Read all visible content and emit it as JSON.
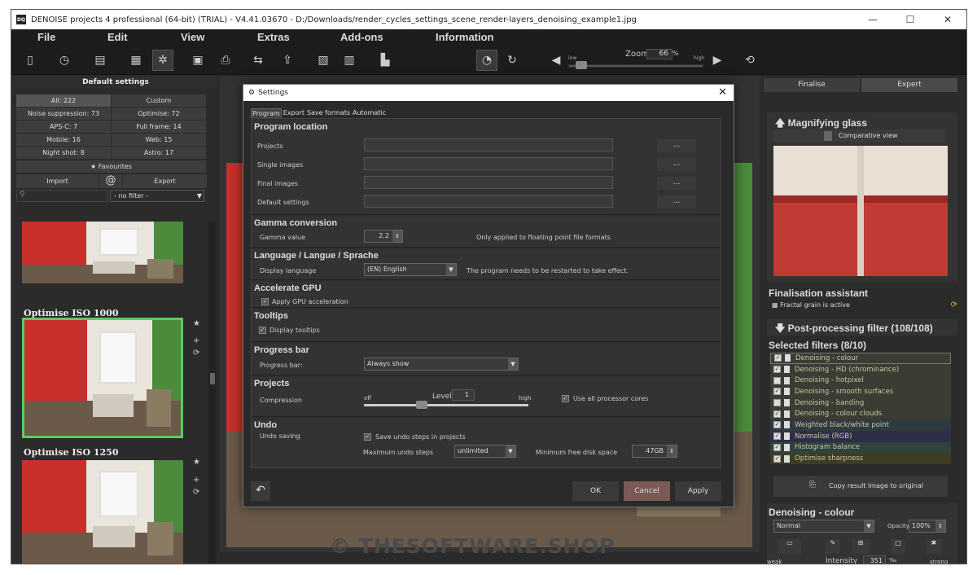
{
  "titlebar": {
    "app_icon": "DQ",
    "title": "DENOISE projects 4 professional (64-bit) (TRIAL) - V4.41.03670 - D:/Downloads/render_cycles_settings_scene_render-layers_denoising_example1.jpg",
    "minimize": "—",
    "maximize": "☐",
    "close": "✕"
  },
  "menu": {
    "file": "File",
    "edit": "Edit",
    "view": "View",
    "extras": "Extras",
    "addons": "Add-ons",
    "information": "Information"
  },
  "zoom": {
    "label": "Zoom",
    "value": "66",
    "unit": "%",
    "low": "low",
    "high": "high"
  },
  "left_panel": {
    "title": "Default settings",
    "presets": [
      {
        "label": "All: 222",
        "active": true
      },
      {
        "label": "Custom"
      },
      {
        "label": "Noise suppression: 73"
      },
      {
        "label": "Optimise: 72"
      },
      {
        "label": "APS-C: 7"
      },
      {
        "label": "Full frame: 14"
      },
      {
        "label": "Mobile: 16"
      },
      {
        "label": "Web: 15"
      },
      {
        "label": "Night shot: 8"
      },
      {
        "label": "Astro: 17"
      }
    ],
    "favourites": "Favourites",
    "import": "Import",
    "at": "@",
    "export": "Export",
    "filter": "- no filter -",
    "thumbs": [
      {
        "label": "Optimise ISO 1000"
      },
      {
        "label": "Optimise ISO 1250"
      }
    ]
  },
  "watermark": "© THESOFTWARE.SHOP",
  "right_panel": {
    "tabs": [
      "Finalise",
      "Expert"
    ],
    "magnifier_title": "Magnifying glass",
    "comparative": "Comparative view",
    "finalisation_title": "Finalisation assistant",
    "fractal": "Fractal grain is active",
    "postfilter_title": "Post-processing filter (108/108)",
    "selected_title": "Selected filters (8/10)",
    "filters": [
      {
        "name": "Denoising - colour",
        "checked": true
      },
      {
        "name": "Denoising - HD (chrominance)",
        "checked": true
      },
      {
        "name": "Denoising - hotpixel",
        "checked": false
      },
      {
        "name": "Denoising - smooth surfaces",
        "checked": true
      },
      {
        "name": "Denoising - banding",
        "checked": false
      },
      {
        "name": "Denoising - colour clouds",
        "checked": true
      },
      {
        "name": "Weighted black/white point",
        "checked": true
      },
      {
        "name": "Normalise (RGB)",
        "checked": true
      },
      {
        "name": "Histogram balance",
        "checked": true
      },
      {
        "name": "Optimise sharpness",
        "checked": true
      }
    ],
    "filter_colors": [
      "#3c3c34",
      "#3c3c34",
      "#3c3c34",
      "#3c3c34",
      "#3c3c34",
      "#3c3c34",
      "#2f3a40",
      "#2e2f46",
      "#2f4240",
      "#3d3c25"
    ],
    "copy_result": "Copy result image to original",
    "denoise_colour_title": "Denoising - colour",
    "blend_mode": "Normal",
    "opacity_label": "Opacity",
    "opacity": "100%",
    "weak": "weak",
    "intensity_label": "Intensity",
    "intensity": "351",
    "intensity_unit": "‰",
    "strong": "strong"
  },
  "dialog": {
    "title": "Settings",
    "tabs": [
      "Program",
      "Export",
      "Save formats",
      "Automatic"
    ],
    "program_location": "Program location",
    "projects": "Projects",
    "single_images": "Single images",
    "final_images": "Final images",
    "default_settings": "Default settings",
    "browse": "...",
    "gamma_title": "Gamma conversion",
    "gamma_label": "Gamma value",
    "gamma_value": "2.2",
    "gamma_note": "Only applied to floating point file formats",
    "language_title": "Language / Langue / Sprache",
    "display_language": "Display language",
    "language_value": "(EN) English",
    "language_note": "The program needs to be restarted to take effect.",
    "gpu_title": "Accelerate GPU",
    "gpu_label": "Apply GPU acceleration",
    "tooltips_title": "Tooltips",
    "tooltips_label": "Display tooltips",
    "progress_title": "Progress bar",
    "progress_label": "Progress bar:",
    "progress_value": "Always show",
    "projects_title": "Projects",
    "compression": "Compression",
    "comp_off": "off",
    "comp_high": "high",
    "level_label": "Level",
    "level_value": "1",
    "compression_level_fraction": 0.35,
    "all_cores": "Use all processor cores",
    "undo_title": "Undo",
    "undo_saving": "Undo saving",
    "save_undo": "Save undo steps in projects",
    "max_undo": "Maximum undo steps",
    "max_undo_value": "unlimited",
    "min_disk": "Minimum free disk space",
    "min_disk_value": "47GB",
    "ok": "OK",
    "cancel": "Cancel",
    "apply": "Apply"
  }
}
